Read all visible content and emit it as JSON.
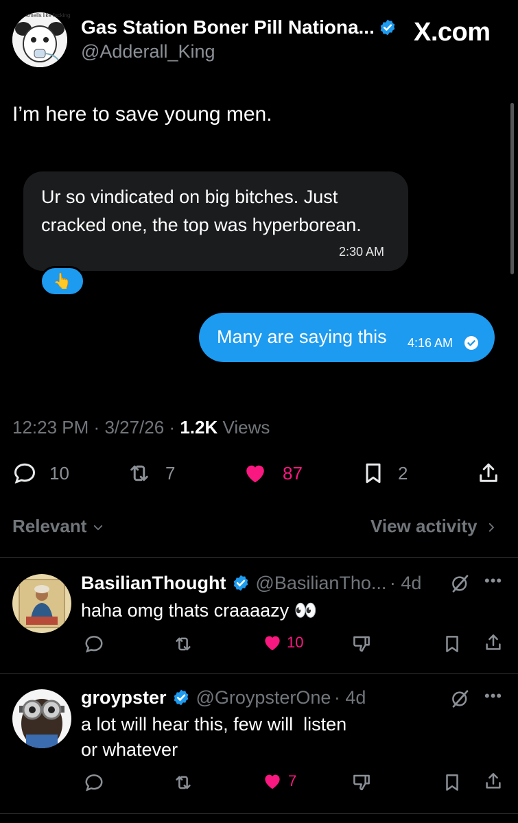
{
  "post": {
    "display_name": "Gas Station Boner Pill Nationa...",
    "handle": "@Adderall_King",
    "avatar_caption": "smells like fucking",
    "watermark": "X.com",
    "text": "I’m here to save young men.",
    "chat": {
      "incoming_text": "Ur so vindicated on big bitches. Just cracked one, the top was hyperborean.",
      "incoming_time": "2:30 AM",
      "reaction_emoji": "👆",
      "outgoing_text": "Many are saying this",
      "outgoing_time": "4:16 AM"
    },
    "time": "12:23 PM",
    "date": "3/27/26",
    "views_count": "1.2K",
    "views_label": "Views",
    "meta_sep": "·",
    "replies": "10",
    "reposts": "7",
    "likes": "87",
    "bookmarks": "2"
  },
  "sort_label": "Relevant",
  "view_activity_label": "View activity",
  "replies": [
    {
      "name": "BasilianThought",
      "handle": "@BasilianTho...",
      "age": "· 4d",
      "text": "haha omg thats craaaazy 👀",
      "likes": "10"
    },
    {
      "name": "groypster",
      "handle": "@GroypsterOne",
      "age": "· 4d",
      "text_line1": "a lot will hear this, few will  listen",
      "text_line2": "or whatever",
      "likes": "7"
    }
  ],
  "colors": {
    "accent": "#1d9bf0",
    "like": "#f91880",
    "muted": "#71767b",
    "bubble_in": "#1b1c1e"
  },
  "icons": [
    "verified-badge-icon",
    "reply-icon",
    "repost-icon",
    "heart-icon",
    "bookmark-icon",
    "share-icon",
    "grok-icon",
    "more-icon",
    "dislike-icon",
    "chevron-down-icon",
    "chevron-right-icon"
  ]
}
